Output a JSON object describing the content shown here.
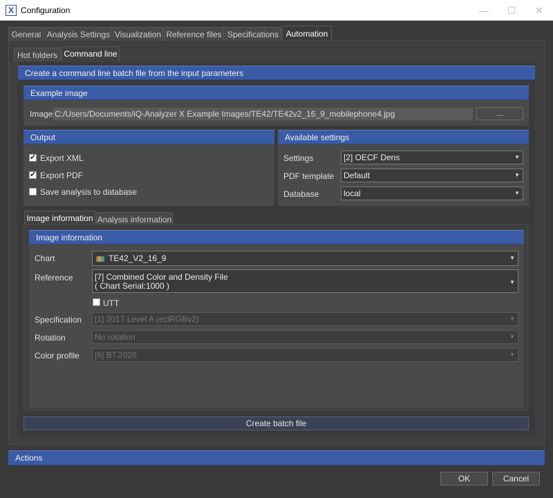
{
  "window": {
    "icon_letter": "X",
    "title": "Configuration",
    "minimize": "—",
    "maximize": "☐",
    "close": "✕"
  },
  "main_tabs": [
    "General",
    "Analysis Settings",
    "Visualization",
    "Reference files",
    "Specifications",
    "Automation"
  ],
  "sub_tabs": [
    "Hot folders",
    "Command line"
  ],
  "command_line": {
    "header": "Create a command line batch file from the input parameters",
    "example_image": {
      "title": "Example image",
      "label": "Image",
      "path": "C:/Users/Documents/iQ-Analyzer X Example Images/TE42/TE42v2_16_9_mobilephone4.jpg",
      "browse": "..."
    },
    "output": {
      "title": "Output",
      "export_xml": "Export XML",
      "export_pdf": "Export PDF",
      "save_db": "Save analysis to database"
    },
    "available_settings": {
      "title": "Available settings",
      "settings_label": "Settings",
      "settings_value": "[2] OECF Dens",
      "pdf_label": "PDF template",
      "pdf_value": "Default",
      "db_label": "Database",
      "db_value": "local"
    },
    "info_tabs": [
      "Image information",
      "Analysis information"
    ],
    "image_info": {
      "title": "Image information",
      "chart_label": "Chart",
      "chart_value": "TE42_V2_16_9",
      "reference_label": "Reference",
      "reference_line1": "[7] Combined Color and Density File",
      "reference_line2": "( Chart Serial:1000 )",
      "utt": "UTT",
      "spec_label": "Specification",
      "spec_value": "[1] 2017 Level A (eciRGBv2)",
      "rotation_label": "Rotation",
      "rotation_value": "No rotation",
      "color_label": "Color profile",
      "color_value": "[6] BT.2020"
    },
    "create_button": "Create batch file"
  },
  "actions": {
    "title": "Actions",
    "ok": "OK",
    "cancel": "Cancel"
  },
  "colors": {
    "accent_blue": "#3a5ba6",
    "panel": "#4a4a4a",
    "background": "#3a3a3a"
  }
}
